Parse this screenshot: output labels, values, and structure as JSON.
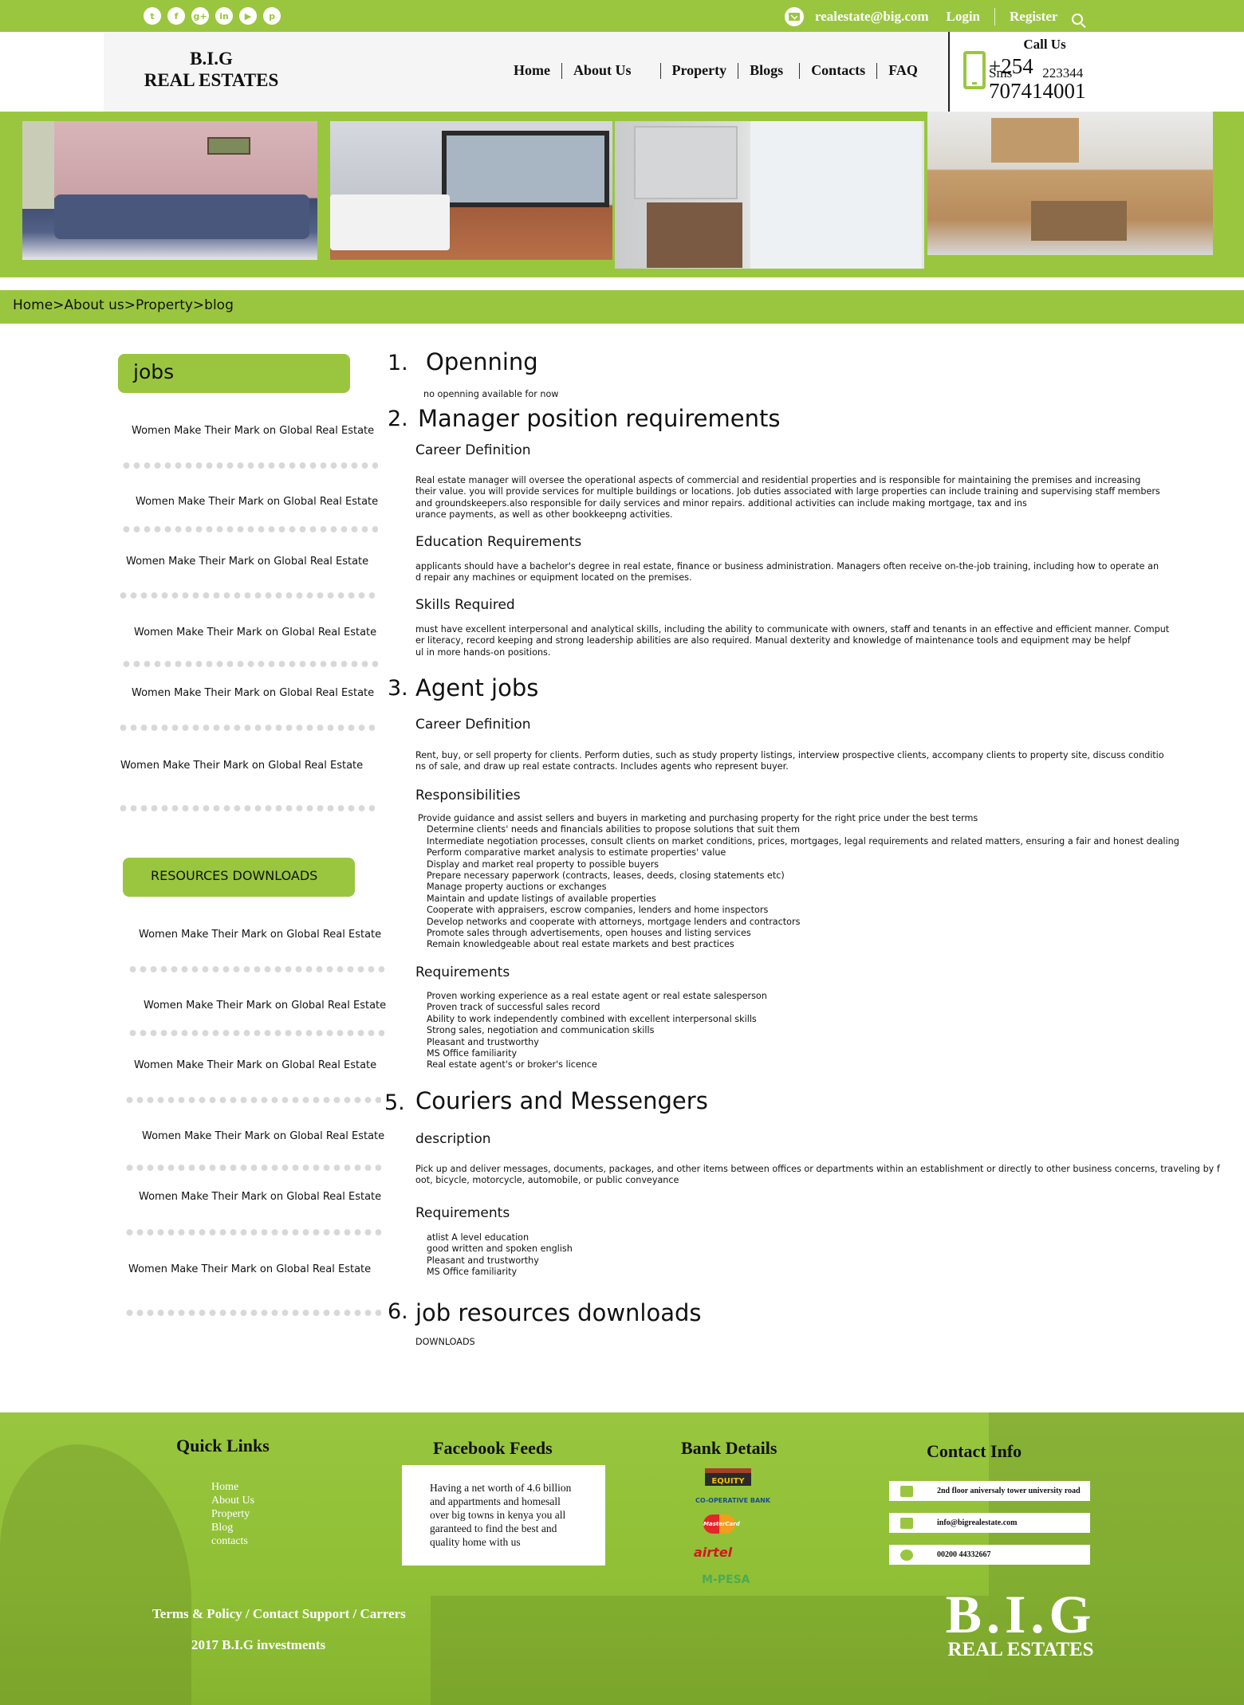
{
  "topbar": {
    "social_icons": [
      "twitter-icon",
      "facebook-icon",
      "google-plus-icon",
      "linkedin-icon",
      "youtube-icon",
      "pinterest-icon"
    ],
    "social_glyphs": [
      "t",
      "f",
      "g+",
      "in",
      "▶",
      "p"
    ],
    "email": "realestate@big.com",
    "login": "Login",
    "register": "Register"
  },
  "header": {
    "logo_line1": "B.I.G",
    "logo_line2": "REAL ESTATES",
    "nav": [
      "Home",
      "About Us",
      "Property",
      "Blogs",
      "Contacts",
      "FAQ"
    ],
    "call_title": "Call Us",
    "phone": "+254 707414001",
    "sms_label": "Sms",
    "sms_number": "223344"
  },
  "breadcrumb": "Home>About us>Property>blog",
  "sidebar": {
    "jobs_title": "jobs",
    "jobs_items": [
      "Women Make Their Mark on Global Real Estate",
      "Women Make Their Mark on Global Real Estate",
      "Women Make Their Mark on Global Real Estate",
      "Women Make Their Mark on Global Real Estate",
      "Women Make Their Mark on Global Real Estate",
      "Women Make Their Mark on Global Real Estate"
    ],
    "resources_title": "RESOURCES DOWNLOADS",
    "resources_items": [
      "Women Make Their Mark on Global Real Estate",
      "Women Make Their Mark on Global Real Estate",
      "Women Make Their Mark on Global Real Estate",
      "Women Make Their Mark on Global Real Estate",
      "Women Make Their Mark on Global Real Estate",
      "Women Make Their Mark on Global Real Estate"
    ]
  },
  "content": {
    "s1": {
      "num": "1.",
      "title": "Openning",
      "text": "no openning available for now"
    },
    "s2": {
      "num": "2.",
      "title": "Manager position requirements",
      "career_h": "Career Definition",
      "career_lines": [
        "Real estate manager will oversee the operational aspects of commercial and residential properties and is responsible for maintaining the premises and increasing",
        "their value. you will provide services for multiple buildings or locations. Job duties associated with large properties can include training and supervising staff members",
        " and groundskeepers.also responsible for daily services and minor repairs. additional activities can include making mortgage, tax and ins",
        "urance payments, as well as other bookkeepng activities."
      ],
      "edu_h": "Education Requirements",
      "edu_lines": [
        "applicants should have a bachelor's degree in real estate, finance or business administration. Managers often receive on-the-job training, including how to operate an",
        "d repair any machines or equipment located on the premises."
      ],
      "skills_h": "Skills Required",
      "skills_lines": [
        "must have excellent interpersonal and analytical skills, including the ability to communicate with owners, staff and tenants in an effective and efficient manner. Comput",
        "er literacy, record keeping and strong leadership abilities are also required. Manual dexterity and knowledge of maintenance tools and equipment may be helpf",
        "ul in more hands-on positions."
      ]
    },
    "s3": {
      "num": "3.",
      "title": "Agent jobs",
      "career_h": "Career Definition",
      "career_lines": [
        "Rent, buy, or sell property for clients. Perform duties, such as study property listings, interview prospective clients, accompany clients to property site, discuss conditio",
        "ns of sale, and draw up real estate contracts. Includes agents who represent buyer."
      ],
      "resp_h": "Responsibilities",
      "resp_lead": "Provide guidance and assist sellers and buyers in marketing and purchasing property for the right price under the best terms",
      "resp_items": [
        "Determine clients' needs and financials abilities to propose solutions that suit them",
        "Intermediate negotiation processes, consult clients on market conditions, prices, mortgages, legal requirements and related matters, ensuring a fair and honest dealing",
        "Perform comparative market analysis to estimate properties' value",
        "Display and market real property to possible buyers",
        "Prepare necessary paperwork (contracts, leases, deeds, closing statements etc)",
        "Manage property auctions or exchanges",
        "Maintain and update listings of available properties",
        "Cooperate with appraisers, escrow companies, lenders and home inspectors",
        "Develop networks and cooperate with attorneys, mortgage lenders and contractors",
        "Promote sales through advertisements, open houses and listing services",
        "Remain knowledgeable about real estate markets and best practices"
      ],
      "req_h": "Requirements",
      "req_items": [
        "Proven working experience as a real estate agent or real estate salesperson",
        "Proven track of successful sales record",
        "Ability to work independently combined with excellent interpersonal skills",
        "Strong sales, negotiation and communication skills",
        "Pleasant and trustworthy",
        "MS Office familiarity",
        "Real estate agent's or broker's licence"
      ]
    },
    "s5": {
      "num": "5.",
      "title": "Couriers and Messengers",
      "desc_h": "description",
      "desc_lines": [
        "Pick up and deliver messages, documents, packages, and other items between offices or departments within an establishment or directly to other business concerns, traveling by f",
        "oot, bicycle, motorcycle, automobile, or public conveyance"
      ],
      "req_h": "Requirements",
      "req_items": [
        "atlist A level education",
        "good written and spoken english",
        "Pleasant and trustworthy",
        "MS Office familiarity"
      ]
    },
    "s6": {
      "num": "6.",
      "title": "job resources downloads",
      "text": "DOWNLOADS"
    }
  },
  "footer": {
    "quick_title": "Quick Links",
    "quick_links": [
      "Home",
      "About Us",
      "Property",
      "Blog",
      "contacts"
    ],
    "fb_title": "Facebook Feeds",
    "fb_lines": [
      "Having a net worth of 4.6 billion",
      "and appartments and homesall",
      "over big towns in kenya you all",
      "garanteed to find the best and",
      "quality home with us"
    ],
    "bank_title": "Bank Details",
    "banks": [
      "EQUITY",
      "CO-OPERATIVE BANK",
      "MasterCard",
      "airtel",
      "M-PESA"
    ],
    "contact_title": "Contact Info",
    "contact_address": "2nd floor aniversaly tower university road",
    "contact_email": "info@bigrealestate.com",
    "contact_phone": "00200 44332667",
    "terms": "Terms & Policy / Contact Support / Carrers",
    "copyright": "2017 B.I.G investments",
    "logo_line1": "B.I.G",
    "logo_line2": "REAL ESTATES"
  }
}
